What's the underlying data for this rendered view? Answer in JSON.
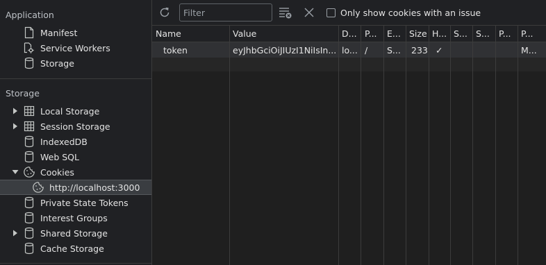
{
  "sidebar": {
    "application_title": "Application",
    "application_items": [
      {
        "label": "Manifest",
        "icon": "document-icon"
      },
      {
        "label": "Service Workers",
        "icon": "gear-icon"
      },
      {
        "label": "Storage",
        "icon": "database-icon"
      }
    ],
    "storage_title": "Storage",
    "storage_items": [
      {
        "label": "Local Storage",
        "icon": "table-icon",
        "expandable": true,
        "expanded": false
      },
      {
        "label": "Session Storage",
        "icon": "table-icon",
        "expandable": true,
        "expanded": false
      },
      {
        "label": "IndexedDB",
        "icon": "database-icon"
      },
      {
        "label": "Web SQL",
        "icon": "database-icon"
      },
      {
        "label": "Cookies",
        "icon": "cookie-icon",
        "expandable": true,
        "expanded": true
      },
      {
        "label": "http://localhost:3000",
        "icon": "cookie-icon",
        "selected": true
      },
      {
        "label": "Private State Tokens",
        "icon": "database-icon"
      },
      {
        "label": "Interest Groups",
        "icon": "database-icon"
      },
      {
        "label": "Shared Storage",
        "icon": "database-icon",
        "expandable": true,
        "expanded": false
      },
      {
        "label": "Cache Storage",
        "icon": "database-icon"
      }
    ]
  },
  "toolbar": {
    "filter_placeholder": "Filter",
    "filter_value": "",
    "only_issues_label": "Only show cookies with an issue",
    "only_issues_checked": false
  },
  "table": {
    "columns": [
      "Name",
      "Value",
      "D...",
      "P...",
      "E...",
      "Size",
      "H...",
      "S...",
      "S...",
      "P...",
      "P..."
    ],
    "rows": [
      [
        "token",
        "eyJhbGciOiJIUzI1NiIsIn...",
        "lo...",
        "/",
        "S...",
        "233",
        "✓",
        "",
        "",
        "",
        "M..."
      ]
    ]
  },
  "colors": {
    "background": "#202124",
    "selected_row": "#303134",
    "border": "#3c3c3c",
    "text": "#e3e3e3",
    "muted": "#bdc1c6"
  }
}
